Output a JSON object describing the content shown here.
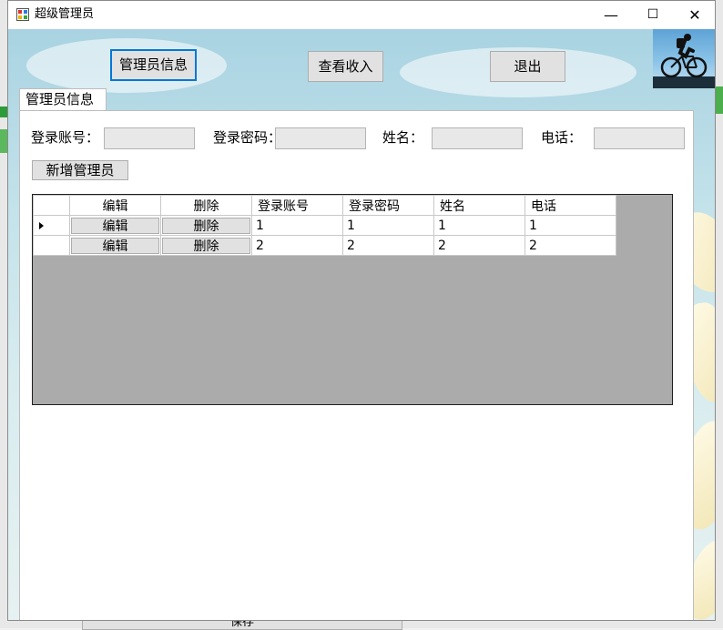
{
  "window": {
    "title": "超级管理员",
    "minimize_glyph": "—",
    "maximize_glyph": "☐",
    "close_glyph": "✕"
  },
  "toolbar": {
    "admin_info_button": "管理员信息",
    "view_income_button": "查看收入",
    "exit_button": "退出"
  },
  "tab": {
    "label": "管理员信息"
  },
  "form": {
    "login_account_label": "登录账号：",
    "login_password_label": "登录密码：",
    "name_label": "姓名：",
    "phone_label": "电话：",
    "login_account_value": "",
    "login_password_value": "",
    "name_value": "",
    "phone_value": "",
    "add_admin_button": "新增管理员"
  },
  "grid": {
    "columns": [
      "编辑",
      "删除",
      "登录账号",
      "登录密码",
      "姓名",
      "电话"
    ],
    "rows": [
      {
        "edit": "编辑",
        "delete": "删除",
        "account": "1",
        "password": "1",
        "name": "1",
        "phone": "1"
      },
      {
        "edit": "编辑",
        "delete": "删除",
        "account": "2",
        "password": "2",
        "name": "2",
        "phone": "2"
      }
    ]
  },
  "background_window": {
    "save_button": "保存"
  },
  "colors": {
    "focus_border": "#0078d7",
    "grid_background": "#ababab",
    "button_face": "#e1e1e1"
  }
}
